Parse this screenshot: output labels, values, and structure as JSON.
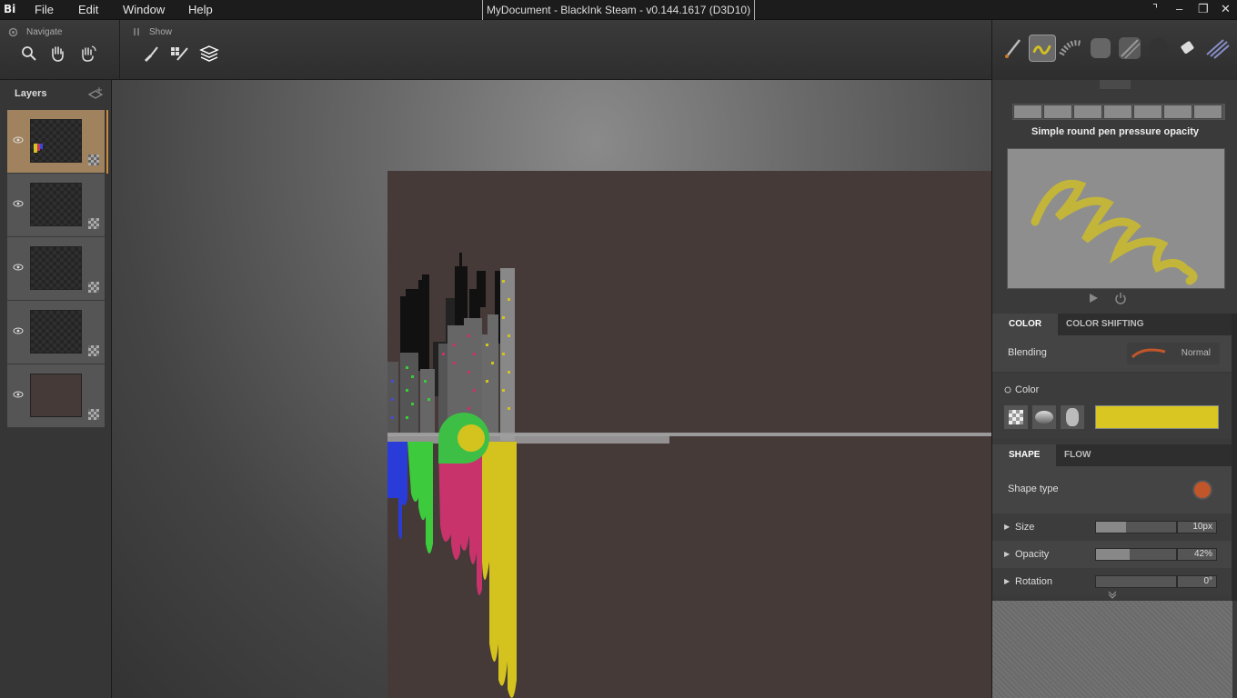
{
  "app": {
    "logo": "Bi",
    "title": "MyDocument - BlackInk Steam - v0.144.1617 (D3D10)"
  },
  "menu": [
    "File",
    "Edit",
    "Window",
    "Help"
  ],
  "toolbar": {
    "navigate_label": "Navigate",
    "show_label": "Show"
  },
  "layers": {
    "title": "Layers",
    "count": 5,
    "active_index": 0
  },
  "brush": {
    "name": "Simple round pen pressure opacity",
    "stroke_color": "#d4c21e"
  },
  "color_tabs": {
    "active": "COLOR",
    "inactive": "COLOR SHIFTING"
  },
  "blending": {
    "label": "Blending",
    "value": "Normal"
  },
  "color": {
    "label": "Color",
    "current": "#d9c622"
  },
  "shape_tabs": {
    "active": "SHAPE",
    "inactive": "FLOW"
  },
  "shape": {
    "type_label": "Shape type",
    "size_label": "Size",
    "size_value": "10px",
    "size_fraction": 0.38,
    "opacity_label": "Opacity",
    "opacity_value": "42%",
    "opacity_fraction": 0.42,
    "rotation_label": "Rotation",
    "rotation_value": "0°",
    "rotation_fraction": 0.0
  },
  "colors": {
    "accent_active_layer": "#a0825f",
    "artboard": "#463a39",
    "shape_dot": "#c0562a"
  }
}
